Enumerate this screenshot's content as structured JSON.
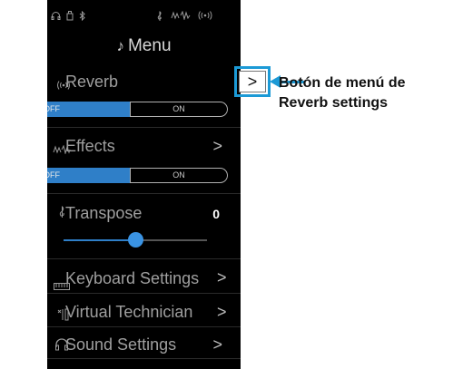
{
  "status_icons": [
    "headphones-icon",
    "usb-icon",
    "bluetooth-icon",
    "treble-clef-icon",
    "effects-wave-icon",
    "reverb-wave-icon"
  ],
  "menu": {
    "title": "Menu",
    "items": [
      {
        "label": "Reverb",
        "icon": "reverb-wave-icon",
        "chevron": ">"
      },
      {
        "label": "Effects",
        "icon": "effects-wave-icon",
        "chevron": ">"
      },
      {
        "label": "Transpose",
        "icon": "treble-clef-icon",
        "value": "0"
      },
      {
        "label": "Keyboard Settings",
        "icon": "keyboard-icon",
        "chevron": ">"
      },
      {
        "label": "Virtual Technician",
        "icon": "technician-icon",
        "chevron": ">"
      },
      {
        "label": "Sound Settings",
        "icon": "headphones-icon",
        "chevron": ">"
      }
    ],
    "reverb_toggle": {
      "off": "OFF",
      "on": "ON",
      "state": "OFF"
    },
    "effects_toggle": {
      "off": "OFF",
      "on": "ON",
      "state": "OFF"
    },
    "transpose_slider_fraction": 0.5
  },
  "highlight": {
    "chevron": ">"
  },
  "callout": {
    "line1": "Botón de menú de",
    "line2": "Reverb settings"
  },
  "colors": {
    "accent": "#2f7fc8",
    "highlight": "#1c9ad6",
    "background": "#000000"
  }
}
